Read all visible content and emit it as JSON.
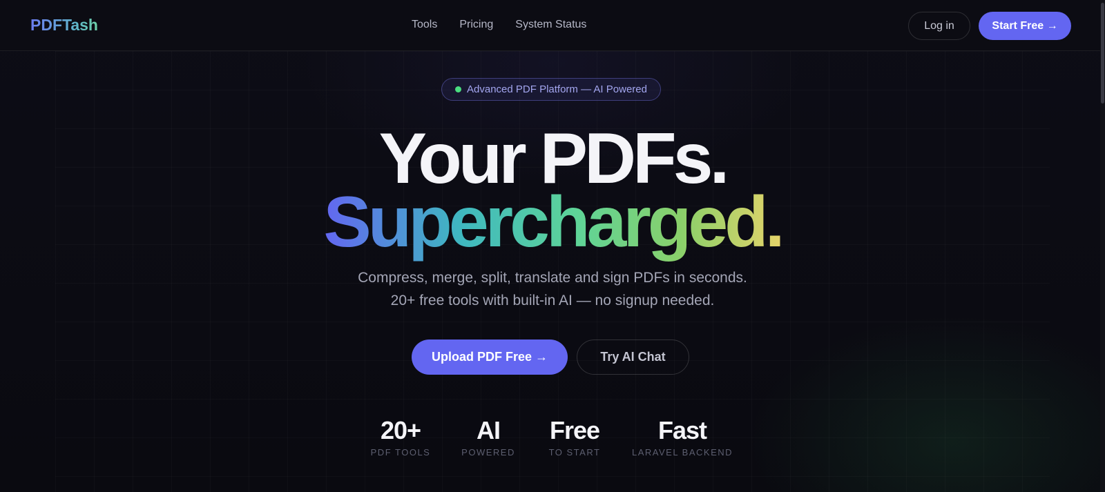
{
  "nav": {
    "logo": "PDFTash",
    "links": [
      "Tools",
      "Pricing",
      "System Status"
    ],
    "login": "Log in",
    "start": "Start Free →"
  },
  "hero": {
    "badge": "Advanced PDF Platform — AI Powered",
    "title_line1": "Your PDFs.",
    "title_line2": "Supercharged.",
    "subtitle_line1": "Compress, merge, split, translate and sign PDFs in seconds.",
    "subtitle_line2": "20+ free tools with built-in AI — no signup needed.",
    "primary_cta": "Upload PDF Free →",
    "secondary_cta": "Try AI Chat"
  },
  "stats": [
    {
      "value": "20+",
      "label": "PDF TOOLS"
    },
    {
      "value": "AI",
      "label": "POWERED"
    },
    {
      "value": "Free",
      "label": "TO START"
    },
    {
      "value": "Fast",
      "label": "LARAVEL BACKEND"
    }
  ],
  "colors": {
    "accent": "#6366f1",
    "background": "#0b0b12",
    "status_dot": "#4ade80"
  }
}
